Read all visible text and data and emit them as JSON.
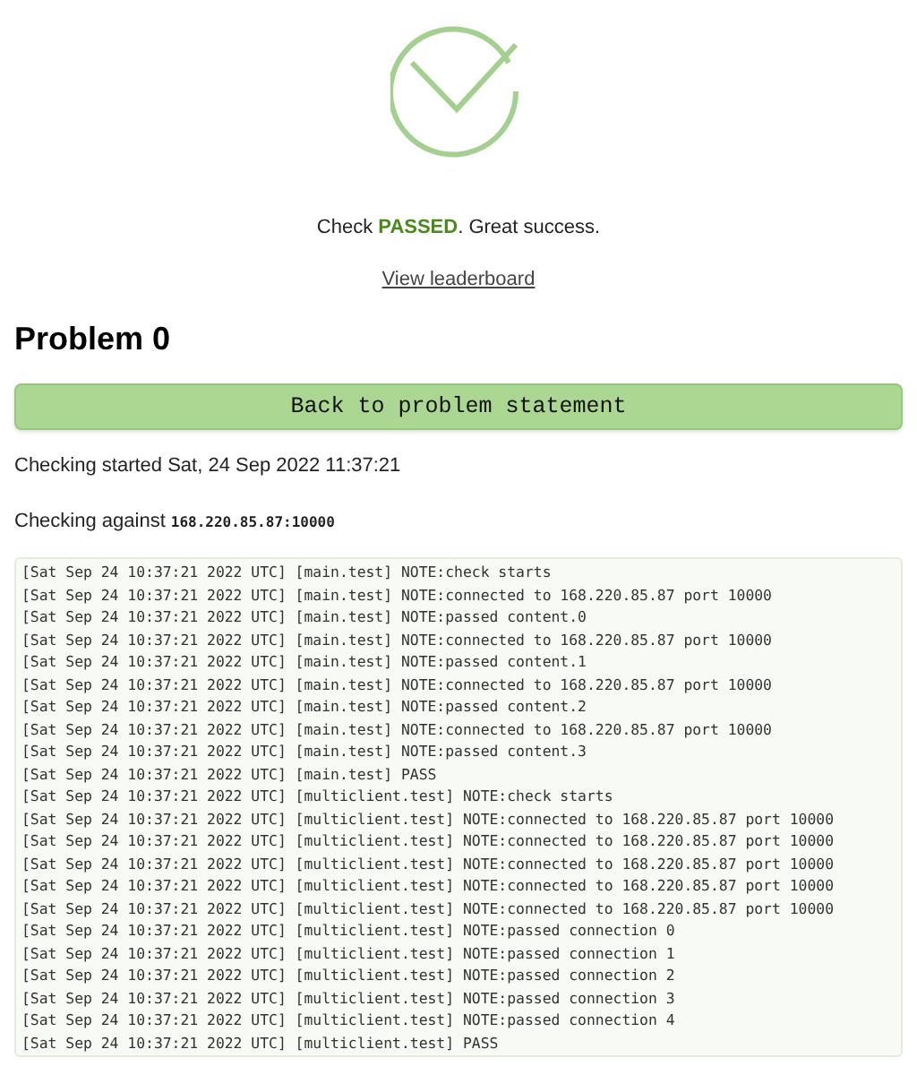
{
  "result": {
    "passed": true,
    "message": "Check **PASSED**. Great success."
  },
  "leaderboard_link": "View leaderboard",
  "problem_title": "Problem 0",
  "back_button": "Back to problem statement",
  "started": "Checking started Sat, 24 Sep 2022 11:37:21",
  "against": {
    "label": "Checking against",
    "address": "168.220.85.87:10000"
  },
  "log": [
    "[Sat Sep 24 10:37:21 2022 UTC] [main.test] NOTE:check starts",
    "[Sat Sep 24 10:37:21 2022 UTC] [main.test] NOTE:connected to 168.220.85.87 port 10000",
    "[Sat Sep 24 10:37:21 2022 UTC] [main.test] NOTE:passed content.0",
    "[Sat Sep 24 10:37:21 2022 UTC] [main.test] NOTE:connected to 168.220.85.87 port 10000",
    "[Sat Sep 24 10:37:21 2022 UTC] [main.test] NOTE:passed content.1",
    "[Sat Sep 24 10:37:21 2022 UTC] [main.test] NOTE:connected to 168.220.85.87 port 10000",
    "[Sat Sep 24 10:37:21 2022 UTC] [main.test] NOTE:passed content.2",
    "[Sat Sep 24 10:37:21 2022 UTC] [main.test] NOTE:connected to 168.220.85.87 port 10000",
    "[Sat Sep 24 10:37:21 2022 UTC] [main.test] NOTE:passed content.3",
    "[Sat Sep 24 10:37:21 2022 UTC] [main.test] PASS",
    "[Sat Sep 24 10:37:21 2022 UTC] [multiclient.test] NOTE:check starts",
    "[Sat Sep 24 10:37:21 2022 UTC] [multiclient.test] NOTE:connected to 168.220.85.87 port 10000",
    "[Sat Sep 24 10:37:21 2022 UTC] [multiclient.test] NOTE:connected to 168.220.85.87 port 10000",
    "[Sat Sep 24 10:37:21 2022 UTC] [multiclient.test] NOTE:connected to 168.220.85.87 port 10000",
    "[Sat Sep 24 10:37:21 2022 UTC] [multiclient.test] NOTE:connected to 168.220.85.87 port 10000",
    "[Sat Sep 24 10:37:21 2022 UTC] [multiclient.test] NOTE:connected to 168.220.85.87 port 10000",
    "[Sat Sep 24 10:37:21 2022 UTC] [multiclient.test] NOTE:passed connection 0",
    "[Sat Sep 24 10:37:21 2022 UTC] [multiclient.test] NOTE:passed connection 1",
    "[Sat Sep 24 10:37:21 2022 UTC] [multiclient.test] NOTE:passed connection 2",
    "[Sat Sep 24 10:37:21 2022 UTC] [multiclient.test] NOTE:passed connection 3",
    "[Sat Sep 24 10:37:21 2022 UTC] [multiclient.test] NOTE:passed connection 4",
    "[Sat Sep 24 10:37:21 2022 UTC] [multiclient.test] PASS"
  ]
}
